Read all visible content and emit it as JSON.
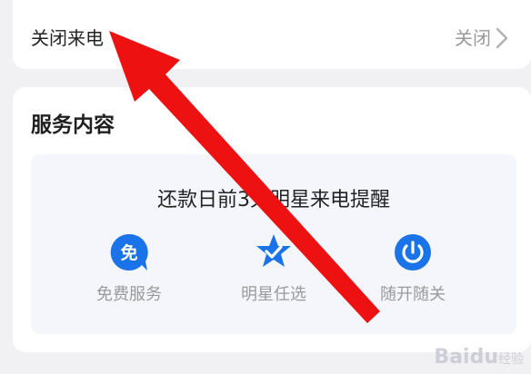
{
  "settings_row": {
    "label": "关闭来电",
    "value": "关闭"
  },
  "service": {
    "title": "服务内容",
    "promo": "还款日前3天明星来电提醒",
    "features": [
      {
        "label": "免费服务",
        "icon": "free-badge-icon",
        "glyph": "免"
      },
      {
        "label": "明星任选",
        "icon": "star-check-icon"
      },
      {
        "label": "随开随关",
        "icon": "power-icon"
      }
    ]
  },
  "colors": {
    "accent": "#1a73e8",
    "arrow": "#ee1111",
    "panel": "#f4f6fb"
  },
  "watermark": {
    "brand": "Baidu",
    "sub": "经验"
  }
}
